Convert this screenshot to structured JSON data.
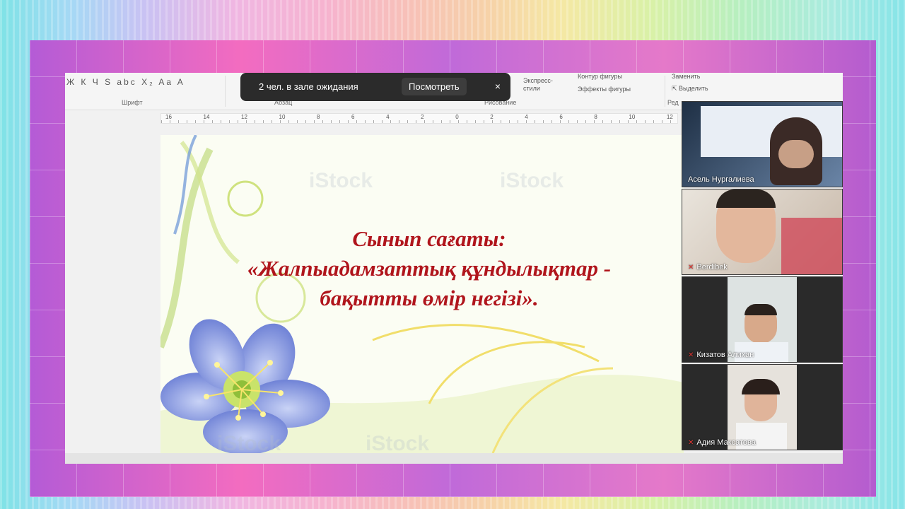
{
  "ribbon": {
    "font_icons": "Ж К Ч S abc X₂ Aa A",
    "group_font": "Шрифт",
    "group_paragraph": "Абзац",
    "group_drawing": "Рисование",
    "express_styles": "Экспресс-\nстили",
    "shape_outline": "Контур фигуры",
    "shape_effects": "Эффекты фигуры",
    "replace": "Заменить",
    "select": "Выделить",
    "group_edit": "Ред"
  },
  "ruler": {
    "numbers": [
      "16",
      "14",
      "12",
      "10",
      "8",
      "6",
      "4",
      "2",
      "0",
      "2",
      "4",
      "6",
      "8",
      "10",
      "12"
    ]
  },
  "notification": {
    "text": "2 чел. в зале ожидания",
    "view_button": "Посмотреть",
    "close": "×"
  },
  "slide": {
    "title_line1": "Сынып сағаты:",
    "title_line2": "«Жалпыадамзаттық құндылықтар -",
    "title_line3": "бақытты өмір негізі».",
    "watermark": "iStock"
  },
  "participants": [
    {
      "name": "Асель Нургалиева",
      "muted": false
    },
    {
      "name": "Berdibek",
      "muted": true
    },
    {
      "name": "Кизатов Алихан",
      "muted": true
    },
    {
      "name": "Адия Максатова",
      "muted": true
    }
  ],
  "colors": {
    "title": "#b0151c",
    "frame": "#c96ad6",
    "mic_muted": "#e53935"
  }
}
